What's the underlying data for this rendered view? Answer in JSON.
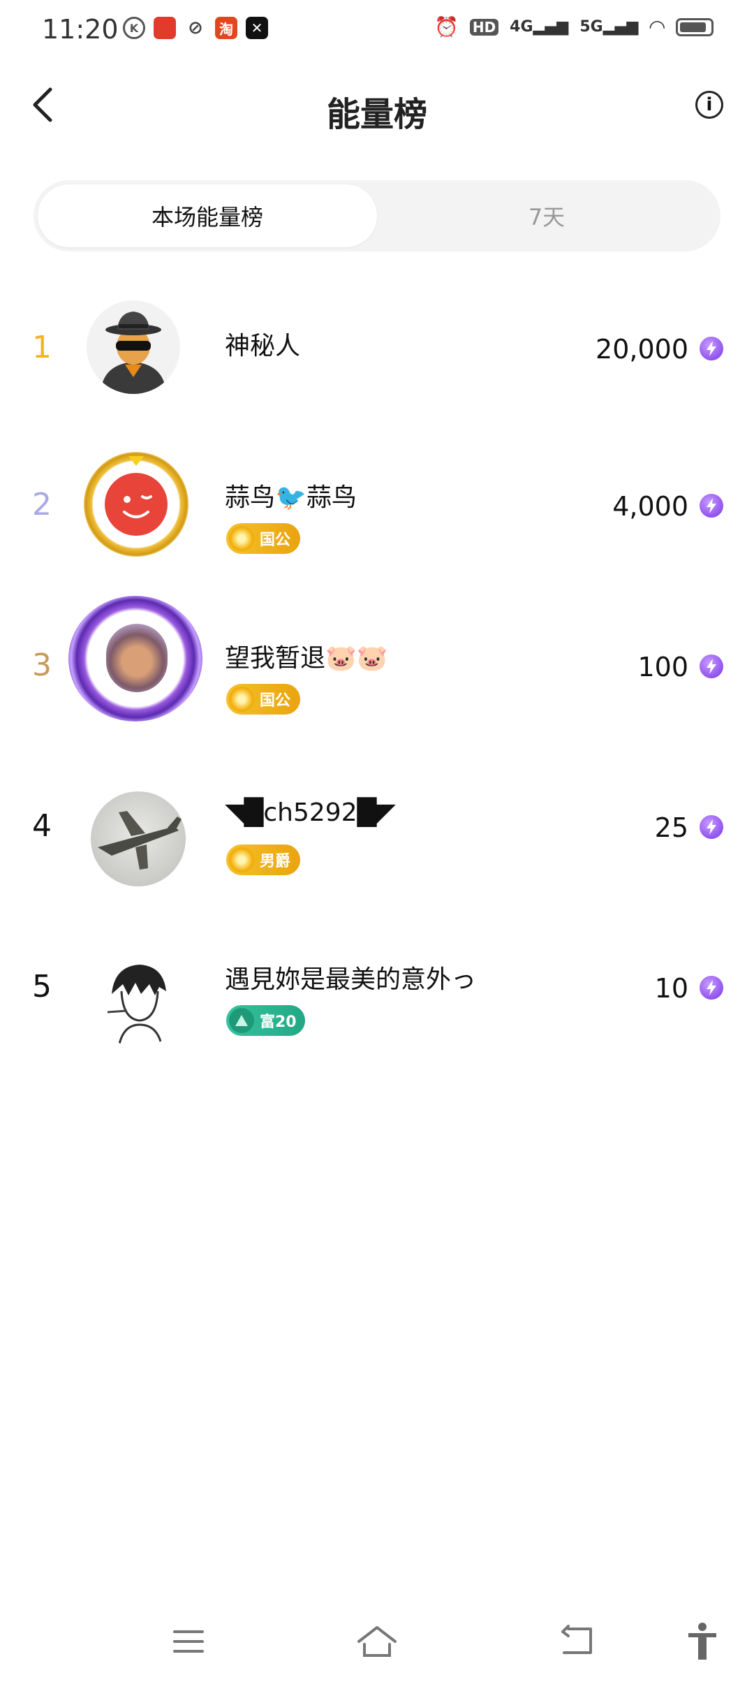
{
  "status_bar": {
    "time": "11:20",
    "network_1": "4G",
    "network_2": "5G",
    "hd": "HD"
  },
  "header": {
    "title": "能量榜",
    "back_icon": "chevron-left-icon",
    "info_icon": "info-icon"
  },
  "tabs": [
    {
      "label": "本场能量榜",
      "active": true
    },
    {
      "label": "7天",
      "active": false
    }
  ],
  "leaderboard": [
    {
      "rank": "1",
      "name": "神秘人",
      "badge": "",
      "score": "20,000"
    },
    {
      "rank": "2",
      "name": "蒜鸟🐦蒜鸟",
      "badge": "国公",
      "score": "4,000"
    },
    {
      "rank": "3",
      "name": "望我暂退🐷🐷",
      "badge": "国公",
      "score": "100"
    },
    {
      "rank": "4",
      "name": "◥█ch5292█◤",
      "badge": "男爵",
      "score": "25"
    },
    {
      "rank": "5",
      "name": "遇見妳是最美的意外っ",
      "badge": "富20",
      "score": "10"
    }
  ],
  "colors": {
    "rank_1": "#f2b321",
    "rank_2": "#a9a9e6",
    "rank_3": "#c89a5a",
    "rank_other": "#111111",
    "gold_badge": "#f0b419",
    "teal_badge": "#2fb593",
    "energy_icon": "#8a3cf0"
  },
  "bottom_nav": [
    "menu-icon",
    "home-icon",
    "back-icon",
    "accessibility-icon"
  ]
}
